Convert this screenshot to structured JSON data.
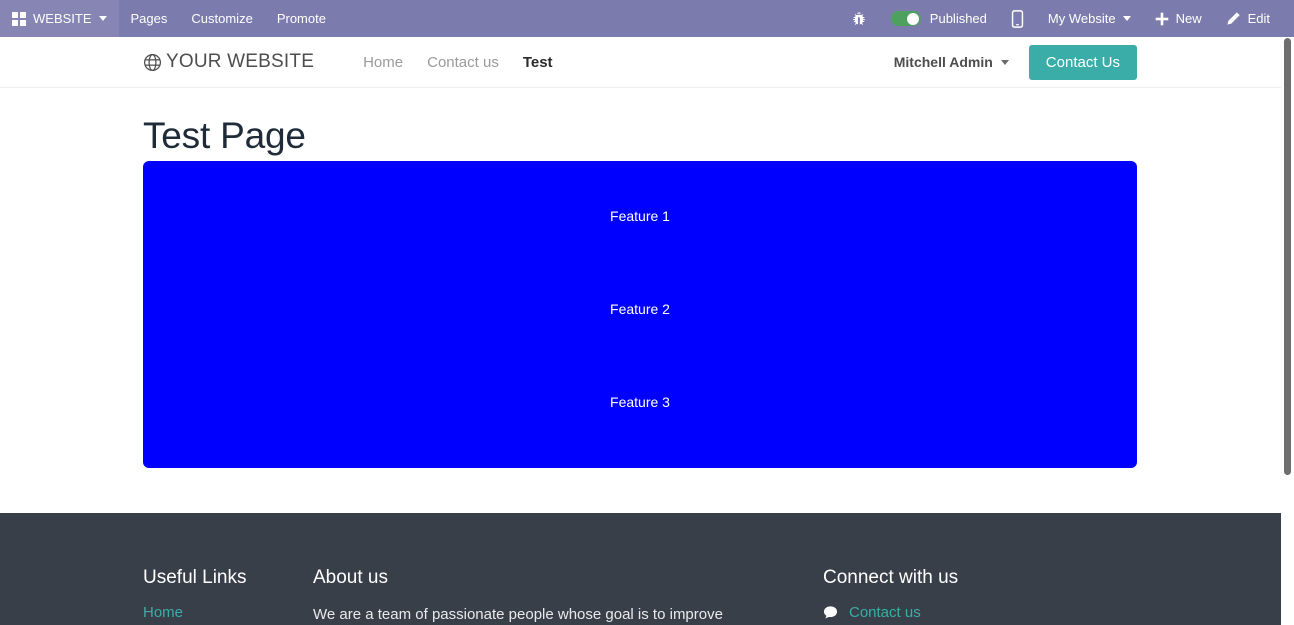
{
  "editor_bar": {
    "apps_label": "WEBSITE",
    "menus": [
      {
        "label": "Pages",
        "name": "pages"
      },
      {
        "label": "Customize",
        "name": "customize"
      },
      {
        "label": "Promote",
        "name": "promote"
      }
    ],
    "debug_icon": "bug-icon",
    "publish_toggle": {
      "label": "Published",
      "state": "on",
      "color": "#4ea05f"
    },
    "mobile_preview_icon": "mobile-icon",
    "website_selector": "My Website",
    "new_label": "New",
    "edit_label": "Edit"
  },
  "site_header": {
    "logo_icon": "globe-icon",
    "brand": "YOUR WEBSITE",
    "nav": [
      {
        "label": "Home",
        "active": false
      },
      {
        "label": "Contact us",
        "active": false
      },
      {
        "label": "Test",
        "active": true
      }
    ],
    "user": "Mitchell Admin",
    "cta_label": "Contact Us",
    "cta_color": "#3aada8"
  },
  "page": {
    "title": "Test Page",
    "feature_block": {
      "background_color": "#0000ff",
      "items": [
        "Feature 1",
        "Feature 2",
        "Feature 3"
      ]
    }
  },
  "footer": {
    "background_color": "#383f48",
    "link_color": "#3aada8",
    "useful_links": {
      "heading": "Useful Links",
      "links": [
        "Home"
      ]
    },
    "about": {
      "heading": "About us",
      "text": "We are a team of passionate people whose goal is to improve"
    },
    "connect": {
      "heading": "Connect with us",
      "icon": "chat-bubble-icon",
      "link": "Contact us"
    }
  }
}
